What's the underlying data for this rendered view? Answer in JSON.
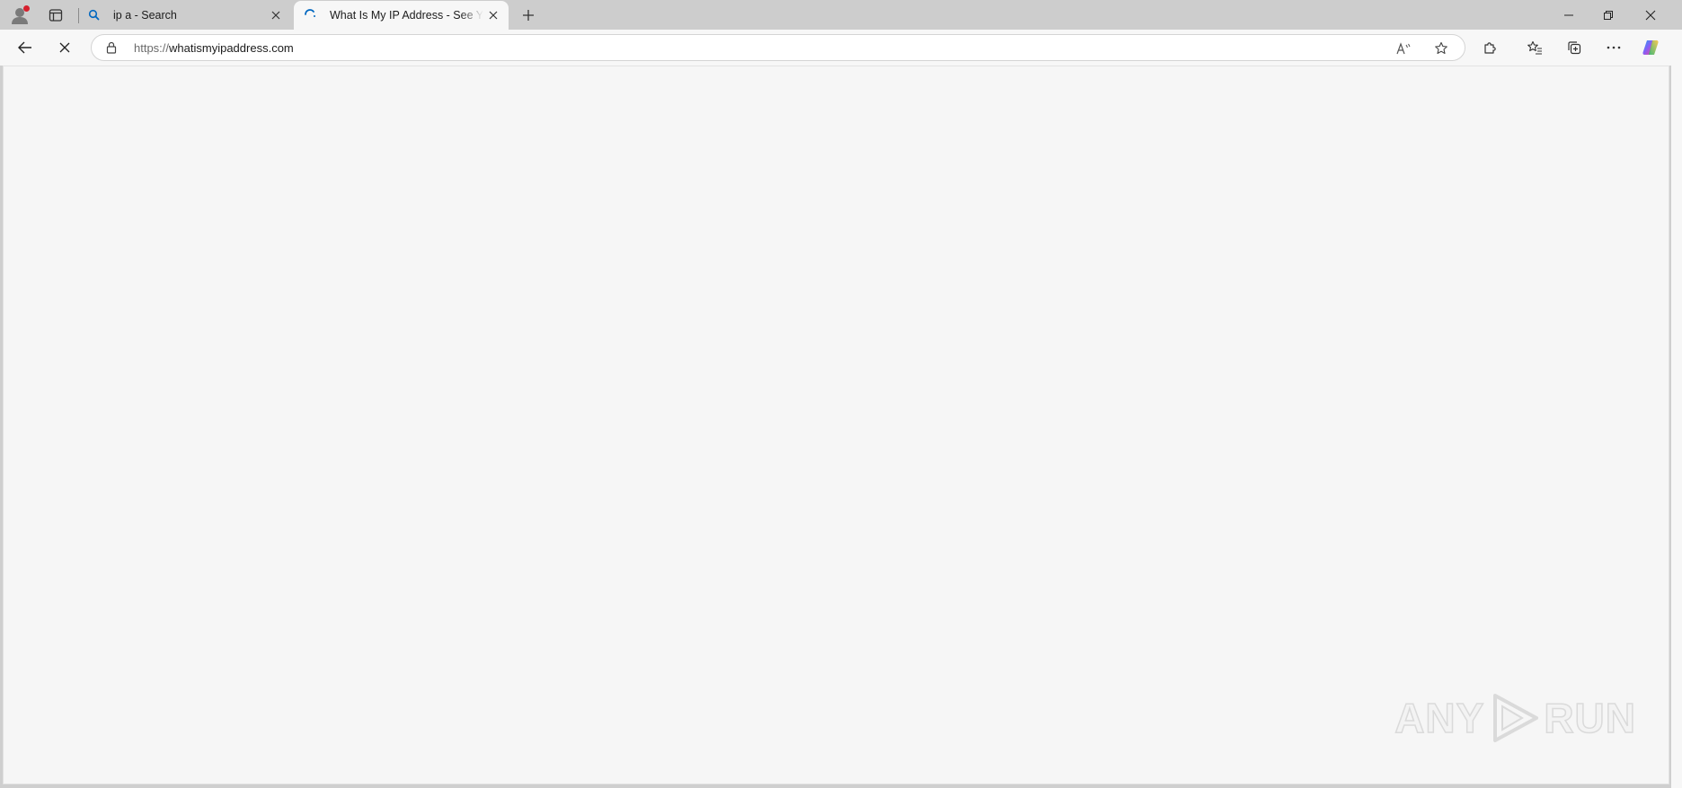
{
  "tabs": [
    {
      "title": "ip a - Search",
      "favicon": "search-icon",
      "state": "inactive"
    },
    {
      "title": "What Is My IP Address - See Your",
      "favicon": "loading-spinner-icon",
      "state": "active-loading"
    }
  ],
  "toolbar": {
    "back_icon": "back-arrow-icon",
    "stop_icon": "stop-loading-icon",
    "url_scheme": "https://",
    "url_host": "whatismyipaddress.com",
    "read_aloud_icon": "read-aloud-icon",
    "favorite_icon": "star-icon",
    "extensions_icon": "puzzle-icon",
    "favorites_icon": "favorites-list-icon",
    "collections_icon": "collections-icon",
    "menu_icon": "more-ellipsis-icon",
    "copilot_icon": "copilot-icon"
  },
  "window_controls": [
    "minimize",
    "restore",
    "close"
  ],
  "watermark": {
    "left": "ANY",
    "right": "RUN"
  },
  "colors": {
    "accent": "#0067c0",
    "tabstrip": "#cdcdcd",
    "content_bg": "#f6f6f6",
    "profile_badge": "#d6202e"
  }
}
